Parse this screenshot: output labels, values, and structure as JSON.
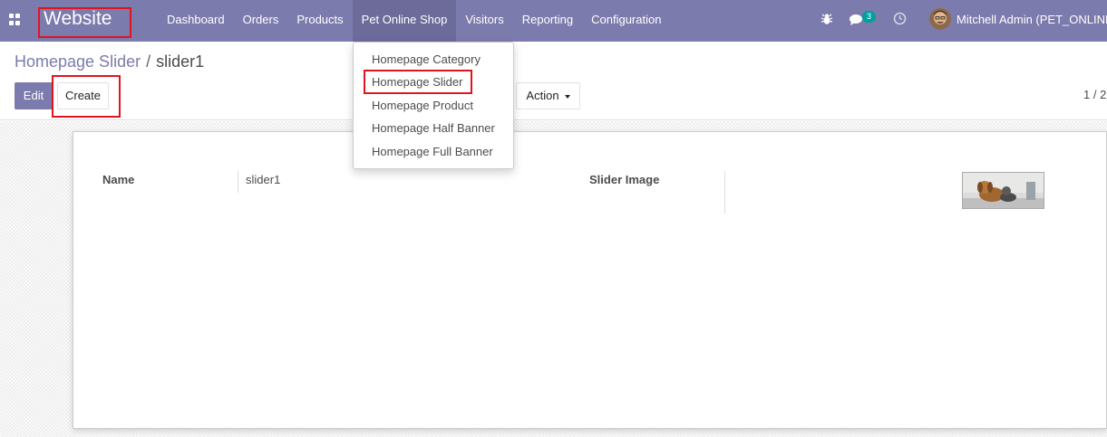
{
  "navbar": {
    "brand": "Website",
    "menu": [
      "Dashboard",
      "Orders",
      "Products",
      "Pet Online Shop",
      "Visitors",
      "Reporting",
      "Configuration"
    ],
    "chat_count": "3",
    "user": "Mitchell Admin (PET_ONLINE"
  },
  "breadcrumb": {
    "parent": "Homepage Slider",
    "separator": "/",
    "current": "slider1"
  },
  "buttons": {
    "edit": "Edit",
    "create": "Create",
    "action": "Action"
  },
  "pager": "1 / 2",
  "form": {
    "name_label": "Name",
    "name_value": "slider1",
    "image_label": "Slider Image"
  },
  "dropdown": {
    "items": [
      "Homepage Category",
      "Homepage Slider",
      "Homepage Product",
      "Homepage Half Banner",
      "Homepage Full Banner"
    ]
  },
  "colors": {
    "navbar": "#7c7bad",
    "highlight": "#e0141e",
    "badge": "#00a09d"
  }
}
